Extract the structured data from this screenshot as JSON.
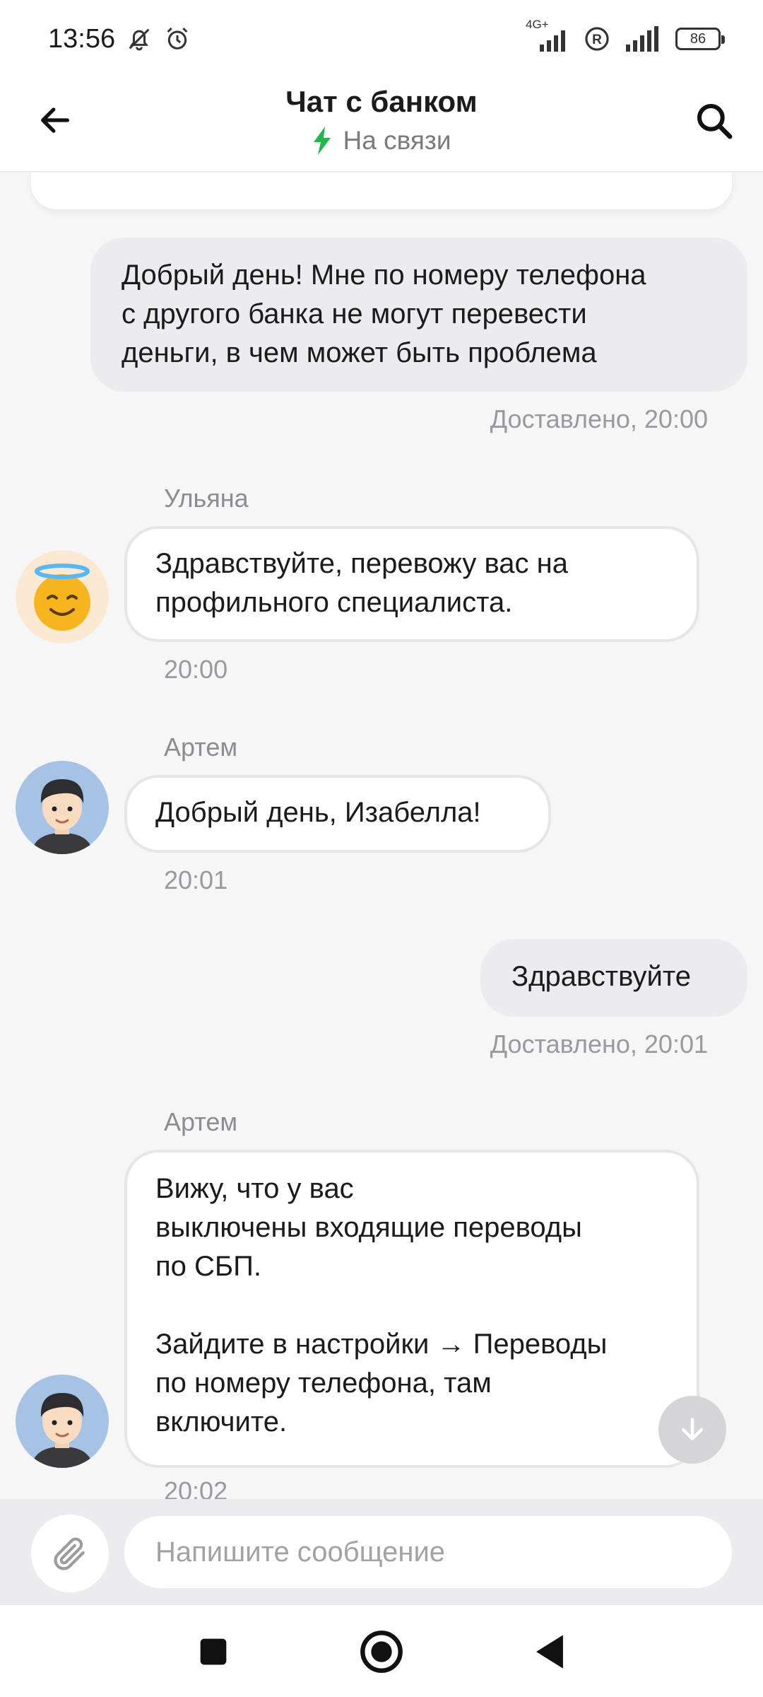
{
  "status_bar": {
    "time": "13:56",
    "network_label": "4G+",
    "battery": "86",
    "icons": [
      "bell-off-icon",
      "alarm-icon",
      "signal-icon",
      "roaming-icon",
      "signal-icon-2",
      "battery-icon"
    ]
  },
  "header": {
    "title": "Чат с банком",
    "status": "На связи",
    "status_color": "#21b84a",
    "back_icon": "arrow-left-icon",
    "search_icon": "search-icon"
  },
  "messages": [
    {
      "direction": "outgoing",
      "lines": [
        "Добрый день! Мне по номеру телефона",
        "с другого банка не могут перевести",
        "деньги, в чем может быть проблема"
      ],
      "meta": "Доставлено, 20:00"
    },
    {
      "direction": "incoming",
      "sender": "Ульяна",
      "avatar": "angel-emoji-avatar",
      "lines": [
        "Здравствуйте, перевожу вас на",
        "профильного специалиста."
      ],
      "time": "20:00"
    },
    {
      "direction": "incoming",
      "sender": "Артем",
      "avatar": "man-avatar",
      "lines": [
        "Добрый день, Изабелла!"
      ],
      "time": "20:01"
    },
    {
      "direction": "outgoing",
      "lines": [
        "Здравствуйте"
      ],
      "meta": "Доставлено, 20:01"
    },
    {
      "direction": "incoming",
      "sender": "Артем",
      "avatar": "man-avatar",
      "lines": [
        "Вижу, что у вас",
        "выключены входящие переводы",
        "по СБП.",
        "",
        "Зайдите в настройки → Переводы",
        "по номеру телефона, там",
        "включите."
      ],
      "time": "20:02"
    }
  ],
  "composer": {
    "placeholder": "Напишите сообщение",
    "attach_icon": "paperclip-icon"
  },
  "scroll_button_icon": "arrow-down-icon",
  "nav_bar": {
    "icons": [
      "square-icon",
      "home-circle-icon",
      "back-triangle-icon"
    ]
  }
}
